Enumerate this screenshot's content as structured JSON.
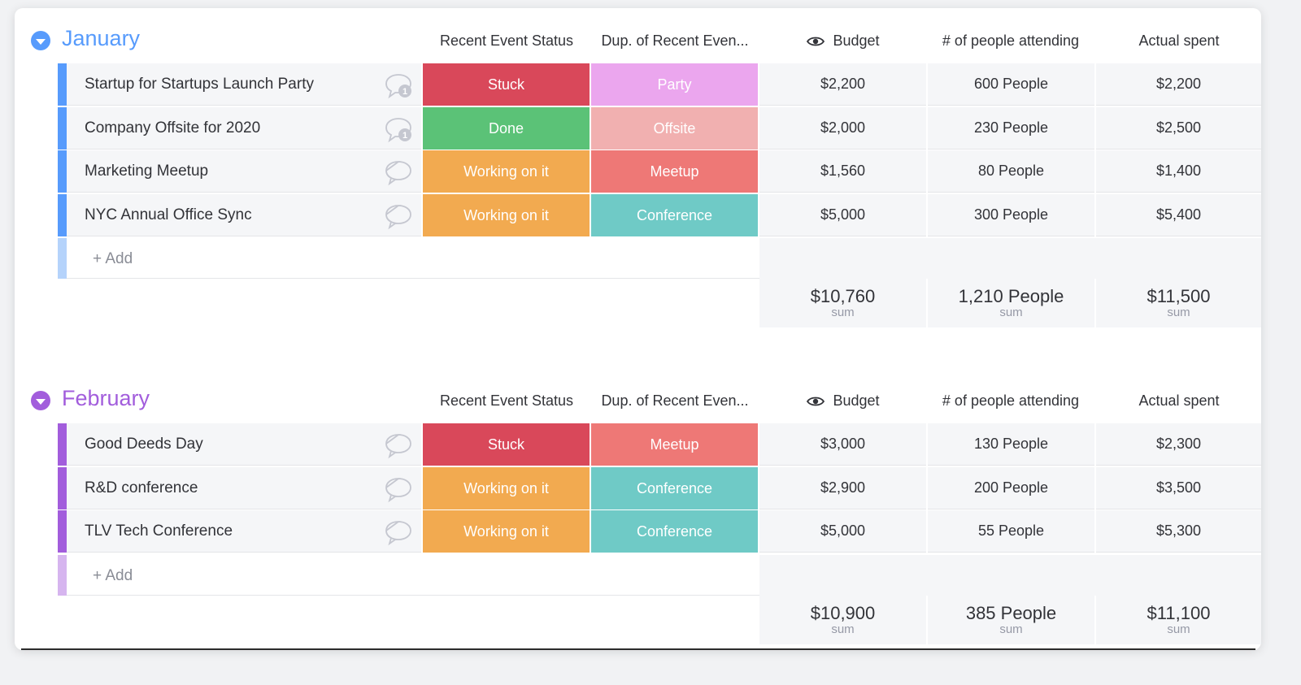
{
  "columns": {
    "status": "Recent Event Status",
    "dup": "Dup. of Recent Even...",
    "budget": "Budget",
    "people": "# of people attending",
    "actual": "Actual spent"
  },
  "add_label": "+ Add",
  "sum_label": "sum",
  "colors": {
    "january_accent": "#579bfc",
    "february_accent": "#a25ddc",
    "stuck": "#e2445c",
    "done": "#00c875",
    "working": "#fdab3d",
    "party": "#f5a6f2",
    "offsite": "#f7b2b2",
    "meetup": "#f37a7a",
    "conference": "#66ccc4"
  },
  "groups": [
    {
      "title": "January",
      "rows": [
        {
          "name": "Startup for Startups Launch Party",
          "comments": "1",
          "status": "Stuck",
          "dup": "Party",
          "budget": "$2,200",
          "people": "600 People",
          "actual": "$2,200"
        },
        {
          "name": "Company Offsite for 2020",
          "comments": "1",
          "status": "Done",
          "dup": "Offsite",
          "budget": "$2,000",
          "people": "230 People",
          "actual": "$2,500"
        },
        {
          "name": "Marketing Meetup",
          "comments": "",
          "status": "Working on it",
          "dup": "Meetup",
          "budget": "$1,560",
          "people": "80 People",
          "actual": "$1,400"
        },
        {
          "name": "NYC Annual Office Sync",
          "comments": "",
          "status": "Working on it",
          "dup": "Conference",
          "budget": "$5,000",
          "people": "300 People",
          "actual": "$5,400"
        }
      ],
      "sum": {
        "budget": "$10,760",
        "people": "1,210 People",
        "actual": "$11,500"
      }
    },
    {
      "title": "February",
      "rows": [
        {
          "name": "Good Deeds Day",
          "comments": "",
          "status": "Stuck",
          "dup": "Meetup",
          "budget": "$3,000",
          "people": "130 People",
          "actual": "$2,300"
        },
        {
          "name": "R&D conference",
          "comments": "",
          "status": "Working on it",
          "dup": "Conference",
          "budget": "$2,900",
          "people": "200 People",
          "actual": "$3,500"
        },
        {
          "name": "TLV Tech Conference",
          "comments": "",
          "status": "Working on it",
          "dup": "Conference",
          "budget": "$5,000",
          "people": "55 People",
          "actual": "$5,300"
        }
      ],
      "sum": {
        "budget": "$10,900",
        "people": "385 People",
        "actual": "$11,100"
      }
    }
  ]
}
